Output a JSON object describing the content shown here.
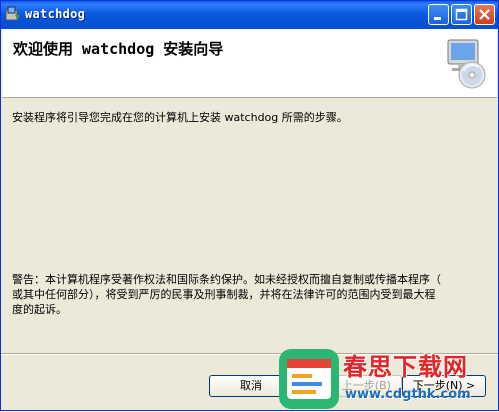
{
  "window": {
    "title": "watchdog",
    "controls": [
      "minimize-icon",
      "maximize-icon",
      "close-icon"
    ]
  },
  "header": {
    "title": "欢迎使用 watchdog 安装向导",
    "icon": "computer-cd-icon"
  },
  "main": {
    "intro": "安装程序将引导您完成在您的计算机上安装 watchdog 所需的步骤。",
    "warning_line1": "警告：本计算机程序受著作权法和国际条约保护。如未经授权而擅自复制或传播本程序（",
    "warning_line2": "或其中任何部分），将受到严厉的民事及刑事制裁，并将在法律许可的范围内受到最大程",
    "warning_line3": "度的起诉。"
  },
  "buttons": {
    "cancel": "取消",
    "back": "< 上一步(B)",
    "next": "下一步(N) >"
  },
  "watermark": {
    "text": "春思下载网",
    "url": "www.cdgthk.com"
  },
  "colors": {
    "titlebar": "#0a56de",
    "dialog_bg": "#ece9d8",
    "watermark_red": "#e0262a",
    "watermark_blue": "#1e6fb8"
  }
}
